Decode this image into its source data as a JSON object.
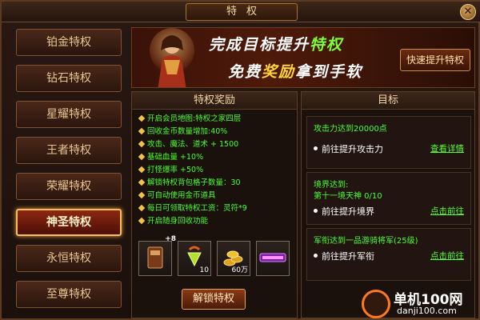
{
  "window": {
    "title": "特权",
    "close_glyph": "✕"
  },
  "sidebar": {
    "items": [
      {
        "label": "铂金特权",
        "active": false
      },
      {
        "label": "钻石特权",
        "active": false
      },
      {
        "label": "星耀特权",
        "active": false
      },
      {
        "label": "王者特权",
        "active": false
      },
      {
        "label": "荣耀特权",
        "active": false
      },
      {
        "label": "神圣特权",
        "active": true
      },
      {
        "label": "永恒特权",
        "active": false
      },
      {
        "label": "至尊特权",
        "active": false
      }
    ]
  },
  "banner": {
    "line1_a": "完成目标提升",
    "line1_b": "特权",
    "line2_a": "免费",
    "line2_b": "奖励",
    "line2_c": "拿到手软",
    "quick_button": "快速提升特权"
  },
  "rewards": {
    "heading": "特权奖励",
    "perks": [
      "开启会员地图:特权之家四层",
      "回收金币数量增加:40%",
      "攻击、魔法、道术 + 1500",
      "基础血量 +10%",
      "打怪爆率 +50%",
      "解锁特权背包格子数量：30",
      "可自动使用金币道具",
      "每日可领取特权工资：灵符*9",
      "开启随身回收功能"
    ],
    "items": [
      {
        "icon": "book-icon",
        "badge": "+8",
        "count": ""
      },
      {
        "icon": "gem-icon",
        "badge": "",
        "count": "10"
      },
      {
        "icon": "gold-coins-icon",
        "badge": "",
        "count": "60万"
      },
      {
        "icon": "vip-card-icon",
        "badge": "",
        "count": ""
      }
    ],
    "unlock_button": "解锁特权"
  },
  "goals": {
    "heading": "目标",
    "cards": [
      {
        "req1": "攻击力达到20000点",
        "req2": "",
        "desc": "前往提升攻击力",
        "link": "查看详情"
      },
      {
        "req1": "境界达到:",
        "req2": "第十一境天神 0/10",
        "desc": "前往提升境界",
        "link": "点击前往"
      },
      {
        "req1": "军衔达到一品游骑将军(25级)",
        "req2": "",
        "desc": "前往提升军衔",
        "link": "点击前往"
      }
    ]
  },
  "watermark": {
    "text1": "单机100网",
    "text2": "danji100.com"
  },
  "colors": {
    "perk_green": "#4dff2d",
    "gold": "#f0c060",
    "active_red": "#8d2712"
  }
}
